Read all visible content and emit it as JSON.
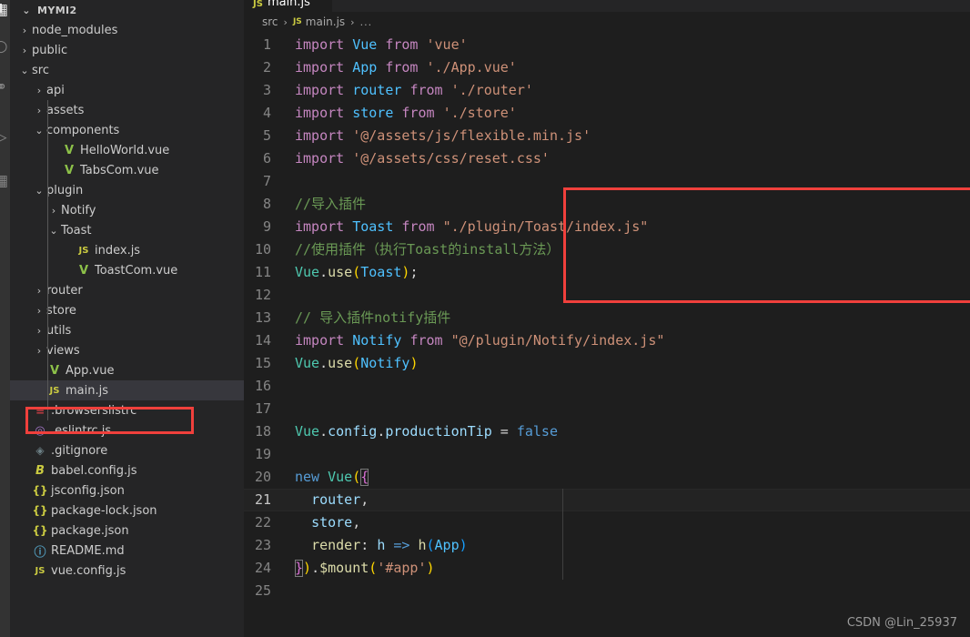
{
  "window": {
    "watermark": "CSDN @Lin_25937"
  },
  "activitybar": {
    "icons": [
      {
        "name": "explorer-icon",
        "glyph": "❐"
      },
      {
        "name": "search-icon",
        "glyph": "○"
      },
      {
        "name": "source-control-icon",
        "glyph": "⑂"
      },
      {
        "name": "run-debug-icon",
        "glyph": "▷"
      },
      {
        "name": "extensions-icon",
        "glyph": "❐"
      }
    ]
  },
  "sidebar": {
    "section_title": "MYMI2",
    "section_twisty": "⌄",
    "tree": [
      {
        "depth": 1,
        "twisty": "›",
        "icon": "",
        "icon_class": "",
        "label": "node_modules"
      },
      {
        "depth": 1,
        "twisty": "›",
        "icon": "",
        "icon_class": "",
        "label": "public"
      },
      {
        "depth": 1,
        "twisty": "⌄",
        "icon": "",
        "icon_class": "",
        "label": "src"
      },
      {
        "depth": 2,
        "twisty": "›",
        "icon": "",
        "icon_class": "",
        "label": "api"
      },
      {
        "depth": 2,
        "twisty": "›",
        "icon": "",
        "icon_class": "",
        "label": "assets"
      },
      {
        "depth": 2,
        "twisty": "⌄",
        "icon": "",
        "icon_class": "",
        "label": "components"
      },
      {
        "depth": 3,
        "twisty": "",
        "icon": "V",
        "icon_class": "ic-vue",
        "label": "HelloWorld.vue"
      },
      {
        "depth": 3,
        "twisty": "",
        "icon": "V",
        "icon_class": "ic-vue",
        "label": "TabsCom.vue"
      },
      {
        "depth": 2,
        "twisty": "⌄",
        "icon": "",
        "icon_class": "",
        "label": "plugin"
      },
      {
        "depth": 3,
        "twisty": "›",
        "icon": "",
        "icon_class": "",
        "label": "Notify"
      },
      {
        "depth": 3,
        "twisty": "⌄",
        "icon": "",
        "icon_class": "",
        "label": "Toast"
      },
      {
        "depth": 4,
        "twisty": "",
        "icon": "JS",
        "icon_class": "ic-js",
        "label": "index.js"
      },
      {
        "depth": 4,
        "twisty": "",
        "icon": "V",
        "icon_class": "ic-vue",
        "label": "ToastCom.vue"
      },
      {
        "depth": 2,
        "twisty": "›",
        "icon": "",
        "icon_class": "",
        "label": "router"
      },
      {
        "depth": 2,
        "twisty": "›",
        "icon": "",
        "icon_class": "",
        "label": "store"
      },
      {
        "depth": 2,
        "twisty": "›",
        "icon": "",
        "icon_class": "",
        "label": "utils"
      },
      {
        "depth": 2,
        "twisty": "›",
        "icon": "",
        "icon_class": "",
        "label": "views"
      },
      {
        "depth": 2,
        "twisty": "",
        "icon": "V",
        "icon_class": "ic-vue",
        "label": "App.vue"
      },
      {
        "depth": 2,
        "twisty": "",
        "icon": "JS",
        "icon_class": "ic-js",
        "label": "main.js",
        "selected": true
      },
      {
        "depth": 1,
        "twisty": "",
        "icon": "≡",
        "icon_class": "ic-list",
        "label": ".browserslistrc"
      },
      {
        "depth": 1,
        "twisty": "",
        "icon": "◎",
        "icon_class": "ic-eslint",
        "label": ".eslintrc.js"
      },
      {
        "depth": 1,
        "twisty": "",
        "icon": "◈",
        "icon_class": "ic-git",
        "label": ".gitignore"
      },
      {
        "depth": 1,
        "twisty": "",
        "icon": "B",
        "icon_class": "ic-babel",
        "label": "babel.config.js"
      },
      {
        "depth": 1,
        "twisty": "",
        "icon": "{}",
        "icon_class": "ic-json",
        "label": "jsconfig.json"
      },
      {
        "depth": 1,
        "twisty": "",
        "icon": "{}",
        "icon_class": "ic-json",
        "label": "package-lock.json"
      },
      {
        "depth": 1,
        "twisty": "",
        "icon": "{}",
        "icon_class": "ic-json",
        "label": "package.json"
      },
      {
        "depth": 1,
        "twisty": "",
        "icon": "ⓘ",
        "icon_class": "ic-md",
        "label": "README.md"
      },
      {
        "depth": 1,
        "twisty": "",
        "icon": "JS",
        "icon_class": "ic-js",
        "label": "vue.config.js"
      }
    ]
  },
  "editor": {
    "tab": {
      "icon": "JS",
      "label": "main.js"
    },
    "breadcrumb": {
      "root": "src",
      "sep": "›",
      "file_icon": "JS",
      "file": "main.js",
      "dots": "..."
    },
    "current_line": 21,
    "lines": [
      {
        "n": 1,
        "tokens": [
          {
            "t": "import ",
            "c": "t-kw"
          },
          {
            "t": "Vue ",
            "c": "t-var"
          },
          {
            "t": "from ",
            "c": "t-kw"
          },
          {
            "t": "'vue'",
            "c": "t-str"
          }
        ]
      },
      {
        "n": 2,
        "tokens": [
          {
            "t": "import ",
            "c": "t-kw"
          },
          {
            "t": "App ",
            "c": "t-var"
          },
          {
            "t": "from ",
            "c": "t-kw"
          },
          {
            "t": "'./App.vue'",
            "c": "t-str"
          }
        ]
      },
      {
        "n": 3,
        "tokens": [
          {
            "t": "import ",
            "c": "t-kw"
          },
          {
            "t": "router ",
            "c": "t-var"
          },
          {
            "t": "from ",
            "c": "t-kw"
          },
          {
            "t": "'./router'",
            "c": "t-str"
          }
        ]
      },
      {
        "n": 4,
        "tokens": [
          {
            "t": "import ",
            "c": "t-kw"
          },
          {
            "t": "store ",
            "c": "t-var"
          },
          {
            "t": "from ",
            "c": "t-kw"
          },
          {
            "t": "'./store'",
            "c": "t-str"
          }
        ]
      },
      {
        "n": 5,
        "tokens": [
          {
            "t": "import ",
            "c": "t-kw"
          },
          {
            "t": "'@/assets/js/flexible.min.js'",
            "c": "t-str"
          }
        ]
      },
      {
        "n": 6,
        "tokens": [
          {
            "t": "import ",
            "c": "t-kw"
          },
          {
            "t": "'@/assets/css/reset.css'",
            "c": "t-str"
          }
        ]
      },
      {
        "n": 7,
        "tokens": []
      },
      {
        "n": 8,
        "tokens": [
          {
            "t": "//导入插件",
            "c": "t-cmt"
          }
        ]
      },
      {
        "n": 9,
        "tokens": [
          {
            "t": "import ",
            "c": "t-kw"
          },
          {
            "t": "Toast ",
            "c": "t-var"
          },
          {
            "t": "from ",
            "c": "t-kw"
          },
          {
            "t": "\"./plugin/Toast/index.js\"",
            "c": "t-str"
          }
        ]
      },
      {
        "n": 10,
        "tokens": [
          {
            "t": "//使用插件（执行Toast的install方法）",
            "c": "t-cmt"
          }
        ]
      },
      {
        "n": 11,
        "tokens": [
          {
            "t": "Vue",
            "c": "t-obj"
          },
          {
            "t": ".",
            "c": "t-punc"
          },
          {
            "t": "use",
            "c": "t-fn"
          },
          {
            "t": "(",
            "c": "t-yellow"
          },
          {
            "t": "Toast",
            "c": "t-var"
          },
          {
            "t": ")",
            "c": "t-yellow"
          },
          {
            "t": ";",
            "c": "t-punc"
          }
        ]
      },
      {
        "n": 12,
        "tokens": []
      },
      {
        "n": 13,
        "tokens": [
          {
            "t": "// 导入插件notify插件",
            "c": "t-cmt"
          }
        ]
      },
      {
        "n": 14,
        "tokens": [
          {
            "t": "import ",
            "c": "t-kw"
          },
          {
            "t": "Notify ",
            "c": "t-var"
          },
          {
            "t": "from ",
            "c": "t-kw"
          },
          {
            "t": "\"@/plugin/Notify/index.js\"",
            "c": "t-str"
          }
        ]
      },
      {
        "n": 15,
        "tokens": [
          {
            "t": "Vue",
            "c": "t-obj"
          },
          {
            "t": ".",
            "c": "t-punc"
          },
          {
            "t": "use",
            "c": "t-fn"
          },
          {
            "t": "(",
            "c": "t-yellow"
          },
          {
            "t": "Notify",
            "c": "t-var"
          },
          {
            "t": ")",
            "c": "t-yellow"
          }
        ]
      },
      {
        "n": 16,
        "tokens": []
      },
      {
        "n": 17,
        "tokens": []
      },
      {
        "n": 18,
        "tokens": [
          {
            "t": "Vue",
            "c": "t-obj"
          },
          {
            "t": ".",
            "c": "t-punc"
          },
          {
            "t": "config",
            "c": "t-prop"
          },
          {
            "t": ".",
            "c": "t-punc"
          },
          {
            "t": "productionTip ",
            "c": "t-prop"
          },
          {
            "t": "= ",
            "c": "t-punc"
          },
          {
            "t": "false",
            "c": "t-ctl"
          }
        ]
      },
      {
        "n": 19,
        "tokens": []
      },
      {
        "n": 20,
        "tokens": [
          {
            "t": "new ",
            "c": "t-ctl"
          },
          {
            "t": "Vue",
            "c": "t-obj"
          },
          {
            "t": "(",
            "c": "t-yellow"
          },
          {
            "t": "{",
            "c": "t-purple"
          }
        ]
      },
      {
        "n": 21,
        "tokens": [
          {
            "t": "  ",
            "c": "t-punc"
          },
          {
            "t": "router",
            "c": "t-prop"
          },
          {
            "t": ",",
            "c": "t-punc"
          }
        ]
      },
      {
        "n": 22,
        "tokens": [
          {
            "t": "  ",
            "c": "t-punc"
          },
          {
            "t": "store",
            "c": "t-prop"
          },
          {
            "t": ",",
            "c": "t-punc"
          }
        ]
      },
      {
        "n": 23,
        "tokens": [
          {
            "t": "  ",
            "c": "t-punc"
          },
          {
            "t": "render",
            "c": "t-fn"
          },
          {
            "t": ": ",
            "c": "t-punc"
          },
          {
            "t": "h ",
            "c": "t-prop"
          },
          {
            "t": "=> ",
            "c": "t-op"
          },
          {
            "t": "h",
            "c": "t-fn"
          },
          {
            "t": "(",
            "c": "t-blue"
          },
          {
            "t": "App",
            "c": "t-var"
          },
          {
            "t": ")",
            "c": "t-blue"
          }
        ]
      },
      {
        "n": 24,
        "tokens": [
          {
            "t": "}",
            "c": "t-purple"
          },
          {
            "t": ")",
            "c": "t-yellow"
          },
          {
            "t": ".",
            "c": "t-punc"
          },
          {
            "t": "$mount",
            "c": "t-fn"
          },
          {
            "t": "(",
            "c": "t-yellow"
          },
          {
            "t": "'#app'",
            "c": "t-str"
          },
          {
            "t": ")",
            "c": "t-yellow"
          }
        ]
      },
      {
        "n": 25,
        "tokens": []
      }
    ]
  },
  "annotations": {
    "code_box_label": "red-highlight-box-toast-plugin",
    "sidebar_box_label": "red-highlight-box-mainjs"
  }
}
